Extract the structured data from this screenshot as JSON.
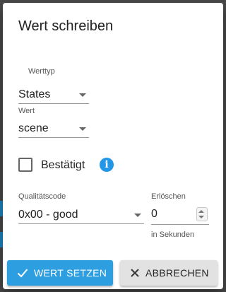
{
  "colors": {
    "accent": "#2d9fe0",
    "info_icon": "#2396e8",
    "secondary_button": "#e2e2e2",
    "backdrop": "#4a4a4a"
  },
  "dialog": {
    "title": "Wert schreiben",
    "value_type": {
      "label": "Werttyp",
      "selected": "States"
    },
    "value": {
      "label": "Wert",
      "selected": "scene"
    },
    "confirmed": {
      "label": "Bestätigt",
      "checked": false,
      "info_icon": "info-icon"
    },
    "quality": {
      "label": "Qualitätscode",
      "selected": "0x00 - good"
    },
    "expire": {
      "label": "Erlöschen",
      "value": "0",
      "helper": "in Sekunden"
    },
    "buttons": {
      "set": {
        "label": "WERT SETZEN",
        "icon": "check-icon"
      },
      "cancel": {
        "label": "ABBRECHEN",
        "icon": "close-icon"
      }
    }
  }
}
